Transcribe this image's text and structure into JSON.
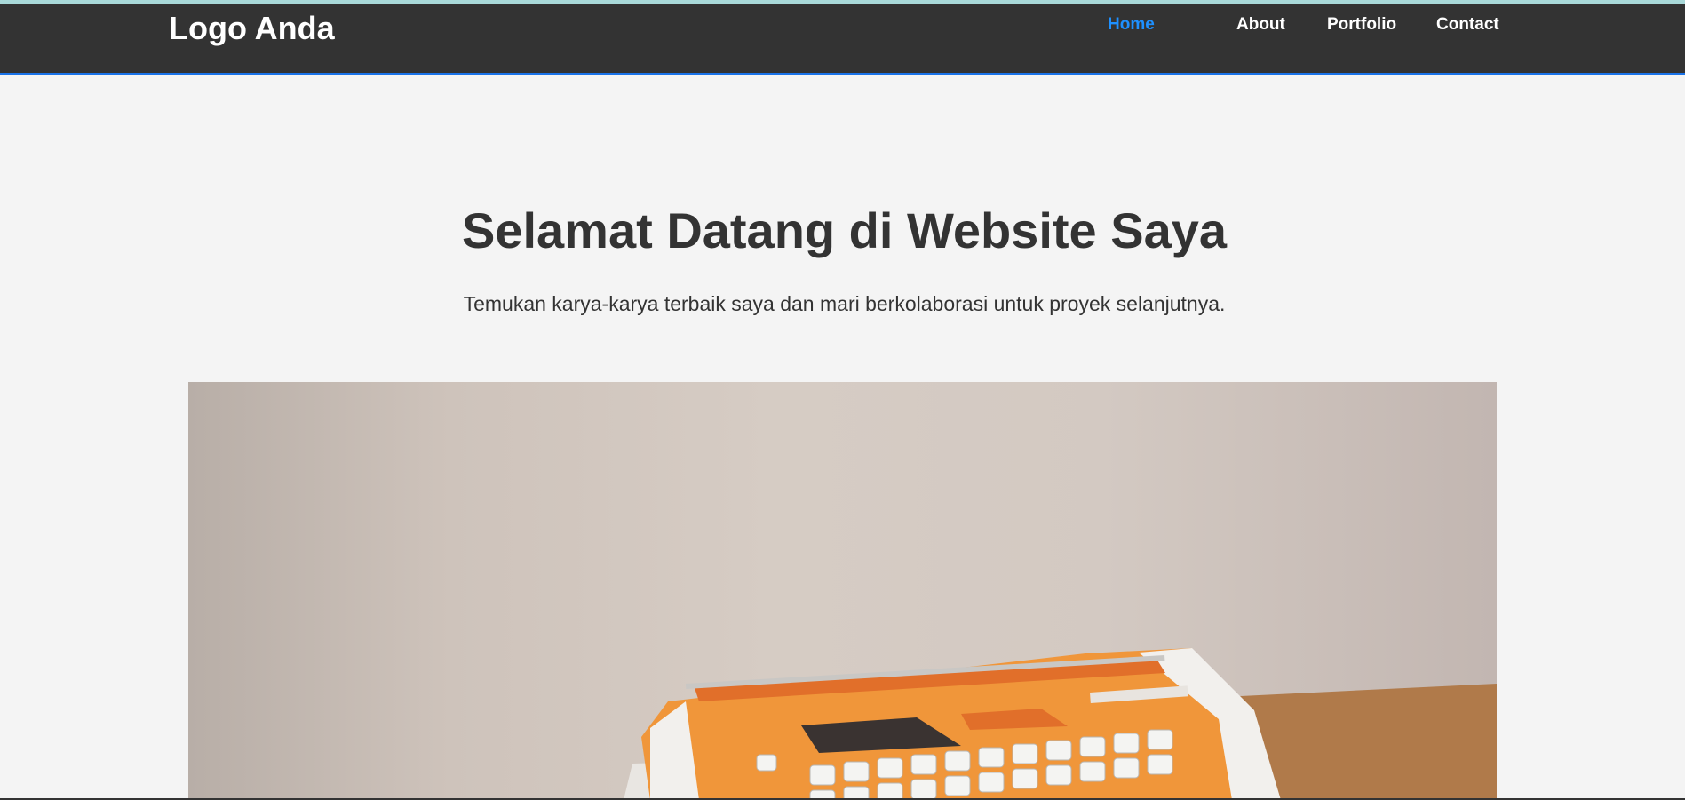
{
  "header": {
    "logo": "Logo Anda",
    "nav": [
      {
        "label": "Home",
        "active": true
      },
      {
        "label": "About",
        "active": false
      },
      {
        "label": "Portfolio",
        "active": false
      },
      {
        "label": "Contact",
        "active": false
      }
    ],
    "colors": {
      "background": "#333333",
      "active_link": "#1e90ff",
      "border": "#1a73e8"
    }
  },
  "hero": {
    "title": "Selamat Datang di Website Saya",
    "subtitle": "Temukan karya-karya terbaik saya dan mari berkolaborasi untuk proyek selanjutnya."
  },
  "image": {
    "icon": "typewriter-photo",
    "colors": {
      "body": "#f0963a",
      "keys": "#f2f2f2",
      "table": "#b07a4a"
    }
  }
}
